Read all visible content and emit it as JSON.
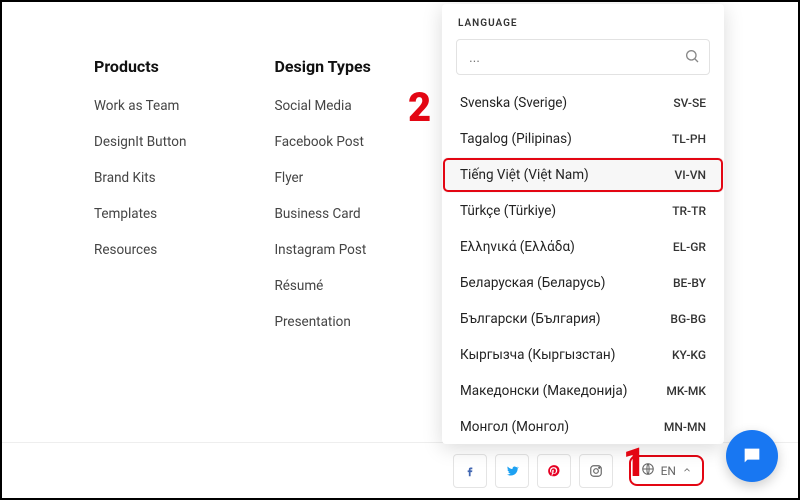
{
  "columns": {
    "products": {
      "title": "Products",
      "items": [
        "Work as Team",
        "DesignIt Button",
        "Brand Kits",
        "Templates",
        "Resources"
      ]
    },
    "designTypes": {
      "title": "Design Types",
      "items": [
        "Social Media",
        "Facebook Post",
        "Flyer",
        "Business Card",
        "Instagram Post",
        "Résumé",
        "Presentation"
      ]
    }
  },
  "languagePanel": {
    "header": "LANGUAGE",
    "searchPlaceholder": "...",
    "items": [
      {
        "name": "Svenska (Sverige)",
        "code": "SV-SE",
        "highlight": false
      },
      {
        "name": "Tagalog (Pilipinas)",
        "code": "TL-PH",
        "highlight": false
      },
      {
        "name": "Tiếng Việt (Việt Nam)",
        "code": "VI-VN",
        "highlight": true
      },
      {
        "name": "Türkçe (Türkiye)",
        "code": "TR-TR",
        "highlight": false
      },
      {
        "name": "Ελληνικά (Ελλάδα)",
        "code": "EL-GR",
        "highlight": false
      },
      {
        "name": "Беларуская (Беларусь)",
        "code": "BE-BY",
        "highlight": false
      },
      {
        "name": "Български (България)",
        "code": "BG-BG",
        "highlight": false
      },
      {
        "name": "Кыргызча (Кыргызстан)",
        "code": "KY-KG",
        "highlight": false
      },
      {
        "name": "Македонски (Македонија)",
        "code": "MK-MK",
        "highlight": false
      },
      {
        "name": "Монгол (Монгол)",
        "code": "MN-MN",
        "highlight": false
      }
    ]
  },
  "bottomBar": {
    "langButton": "EN"
  },
  "callouts": {
    "one": "1",
    "two": "2"
  }
}
